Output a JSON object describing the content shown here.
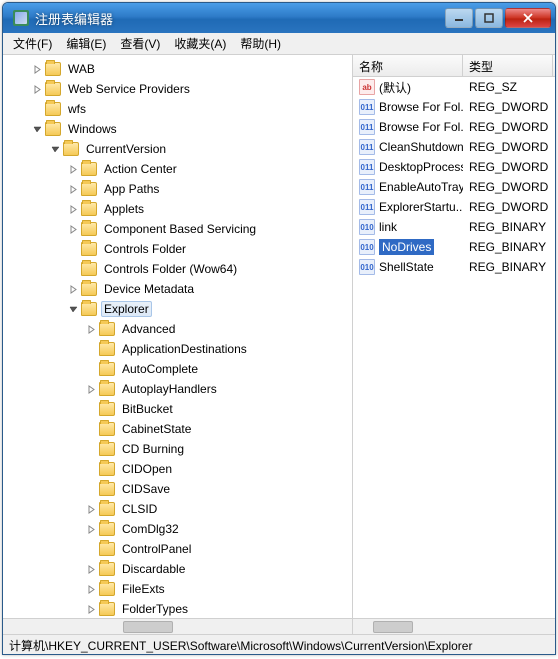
{
  "window": {
    "title": "注册表编辑器"
  },
  "menu": {
    "file": "文件(F)",
    "edit": "编辑(E)",
    "view": "查看(V)",
    "favorites": "收藏夹(A)",
    "help": "帮助(H)"
  },
  "tree": [
    {
      "indent": 1,
      "exp": "closed",
      "label": "WAB"
    },
    {
      "indent": 1,
      "exp": "closed",
      "label": "Web Service Providers"
    },
    {
      "indent": 1,
      "exp": "none",
      "label": "wfs"
    },
    {
      "indent": 1,
      "exp": "open",
      "label": "Windows"
    },
    {
      "indent": 2,
      "exp": "open",
      "label": "CurrentVersion"
    },
    {
      "indent": 3,
      "exp": "closed",
      "label": "Action Center"
    },
    {
      "indent": 3,
      "exp": "closed",
      "label": "App Paths"
    },
    {
      "indent": 3,
      "exp": "closed",
      "label": "Applets"
    },
    {
      "indent": 3,
      "exp": "closed",
      "label": "Component Based Servicing"
    },
    {
      "indent": 3,
      "exp": "none",
      "label": "Controls Folder"
    },
    {
      "indent": 3,
      "exp": "none",
      "label": "Controls Folder (Wow64)"
    },
    {
      "indent": 3,
      "exp": "closed",
      "label": "Device Metadata"
    },
    {
      "indent": 3,
      "exp": "open",
      "label": "Explorer",
      "selected": true
    },
    {
      "indent": 4,
      "exp": "closed",
      "label": "Advanced"
    },
    {
      "indent": 4,
      "exp": "none",
      "label": "ApplicationDestinations"
    },
    {
      "indent": 4,
      "exp": "none",
      "label": "AutoComplete"
    },
    {
      "indent": 4,
      "exp": "closed",
      "label": "AutoplayHandlers"
    },
    {
      "indent": 4,
      "exp": "none",
      "label": "BitBucket"
    },
    {
      "indent": 4,
      "exp": "none",
      "label": "CabinetState"
    },
    {
      "indent": 4,
      "exp": "none",
      "label": "CD Burning"
    },
    {
      "indent": 4,
      "exp": "none",
      "label": "CIDOpen"
    },
    {
      "indent": 4,
      "exp": "none",
      "label": "CIDSave"
    },
    {
      "indent": 4,
      "exp": "closed",
      "label": "CLSID"
    },
    {
      "indent": 4,
      "exp": "closed",
      "label": "ComDlg32"
    },
    {
      "indent": 4,
      "exp": "none",
      "label": "ControlPanel"
    },
    {
      "indent": 4,
      "exp": "closed",
      "label": "Discardable"
    },
    {
      "indent": 4,
      "exp": "closed",
      "label": "FileExts"
    },
    {
      "indent": 4,
      "exp": "closed",
      "label": "FolderTypes"
    }
  ],
  "list": {
    "headers": {
      "name": "名称",
      "type": "类型"
    },
    "rows": [
      {
        "icon": "str",
        "name": "(默认)",
        "type": "REG_SZ"
      },
      {
        "icon": "num",
        "name": "Browse For Fol...",
        "type": "REG_DWORD"
      },
      {
        "icon": "num",
        "name": "Browse For Fol...",
        "type": "REG_DWORD"
      },
      {
        "icon": "num",
        "name": "CleanShutdown",
        "type": "REG_DWORD"
      },
      {
        "icon": "num",
        "name": "DesktopProcess",
        "type": "REG_DWORD"
      },
      {
        "icon": "num",
        "name": "EnableAutoTray",
        "type": "REG_DWORD"
      },
      {
        "icon": "num",
        "name": "ExplorerStartu...",
        "type": "REG_DWORD"
      },
      {
        "icon": "bin",
        "name": "link",
        "type": "REG_BINARY"
      },
      {
        "icon": "bin",
        "name": "NoDrives",
        "type": "REG_BINARY",
        "selected": true
      },
      {
        "icon": "bin",
        "name": "ShellState",
        "type": "REG_BINARY"
      }
    ]
  },
  "statusbar": "计算机\\HKEY_CURRENT_USER\\Software\\Microsoft\\Windows\\CurrentVersion\\Explorer",
  "icon_labels": {
    "str": "ab",
    "num": "011",
    "bin": "010"
  }
}
